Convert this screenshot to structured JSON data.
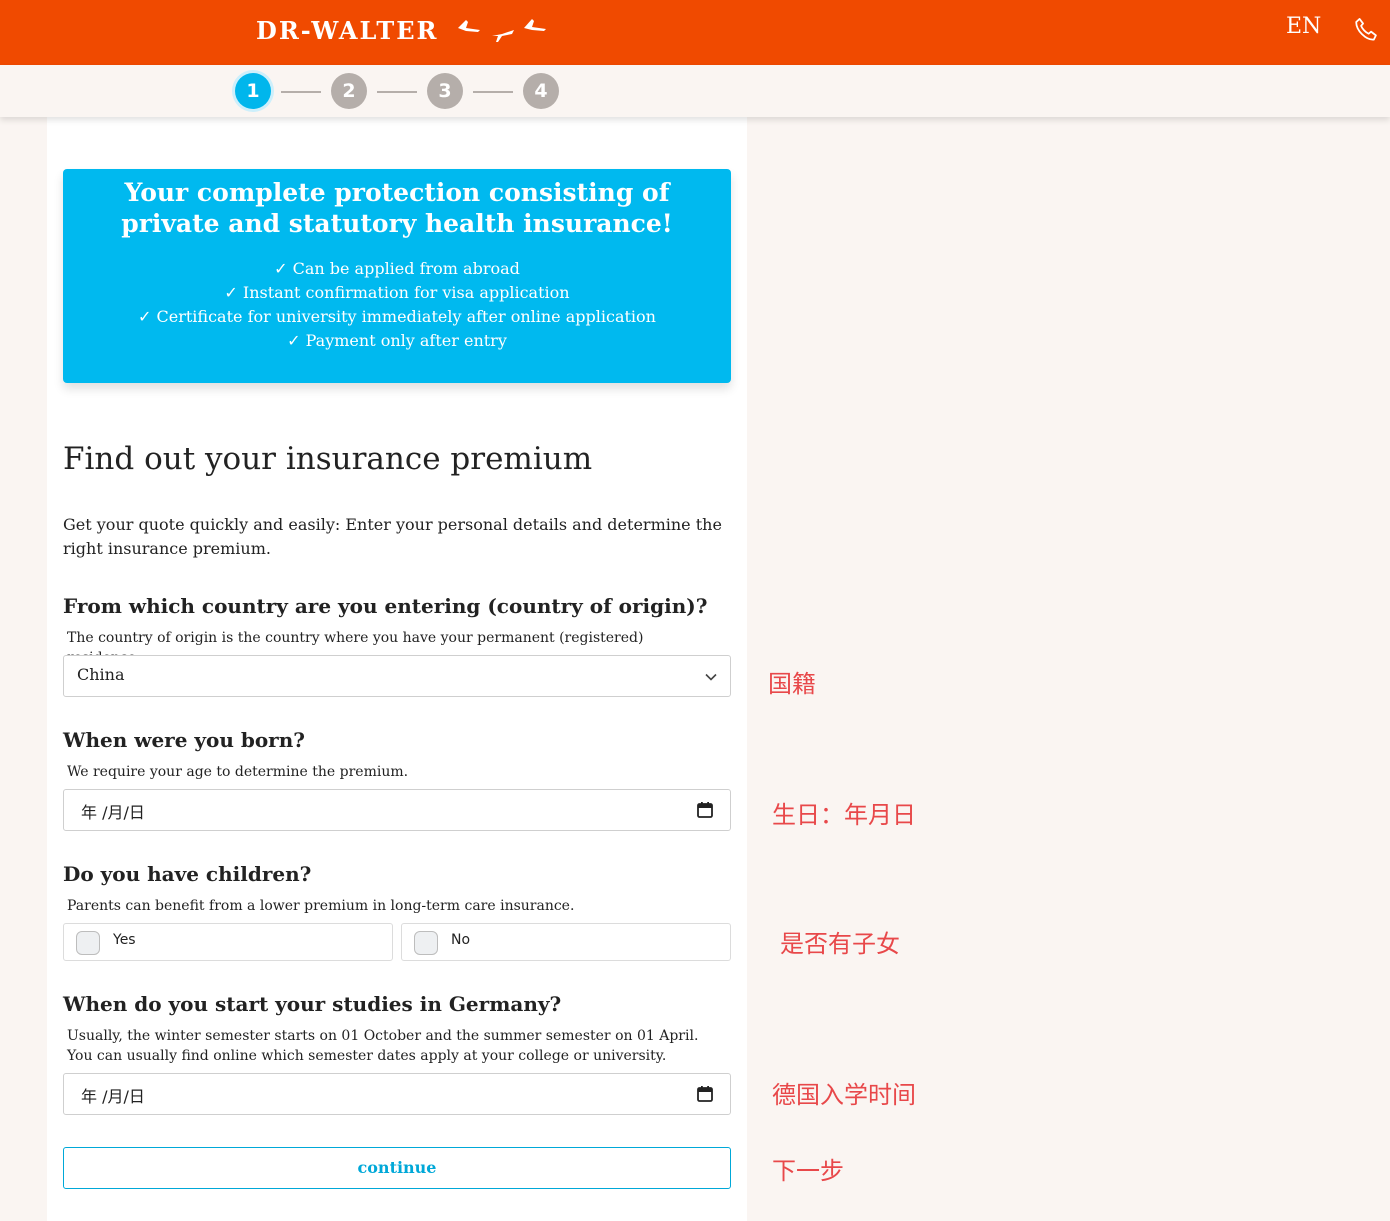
{
  "header": {
    "logo": "DR-WALTER",
    "language": "EN"
  },
  "stepper": {
    "steps": [
      "1",
      "2",
      "3",
      "4"
    ],
    "active": 1
  },
  "banner": {
    "title": "Your complete protection consisting of private and statutory health insurance!",
    "features": [
      "✓ Can be applied from abroad",
      "✓ Instant confirmation for visa application",
      "✓ Certificate for university immediately after online application",
      "✓ Payment only after entry"
    ]
  },
  "form": {
    "heading": "Find out your insurance premium",
    "intro": "Get your quote quickly and easily: Enter your personal details and determine the right insurance premium.",
    "country": {
      "label": "From which country are you entering (country of origin)?",
      "help": "The country of origin is the country where you have your permanent (registered) residence.",
      "value": "China"
    },
    "birth": {
      "label": "When were you born?",
      "help": "We require your age to determine the premium.",
      "value": "年 /月/日"
    },
    "children": {
      "label": "Do you have children?",
      "help": "Parents can benefit from a lower premium in long-term care insurance.",
      "options": [
        "Yes",
        "No"
      ]
    },
    "studies": {
      "label": "When do you start your studies in Germany?",
      "help": "Usually, the winter semester starts on 01 October and the summer semester on 01 April. You can usually find online which semester dates apply at your college or university.",
      "value": "年 /月/日"
    },
    "continue_label": "continue"
  },
  "annotations": {
    "country": "国籍",
    "birth": "生日：年月日",
    "children": "是否有子女",
    "studies": "德国入学时间",
    "continue": "下一步"
  },
  "colors": {
    "brand": "#f04a00",
    "accent": "#00b9ef",
    "annotation": "#e8484a"
  }
}
